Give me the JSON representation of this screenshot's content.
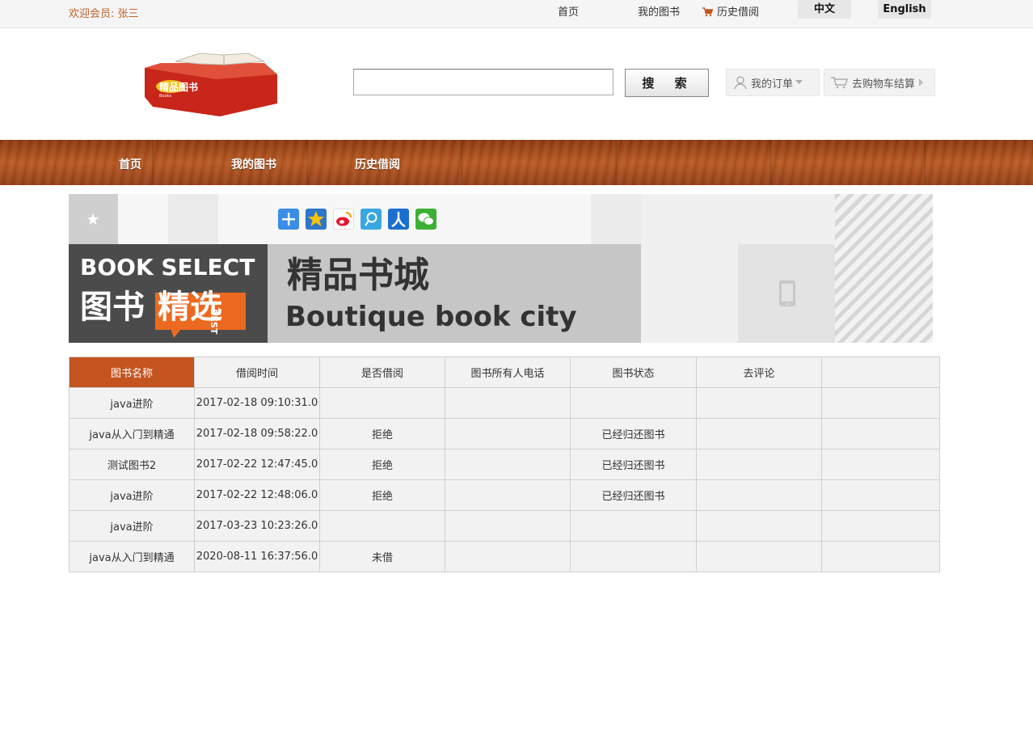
{
  "topbar": {
    "welcome": "欢迎会员: 张三",
    "links": [
      "首页",
      "我的图书",
      "历史借阅"
    ],
    "lang_zh": "中文",
    "lang_en": "English"
  },
  "header": {
    "logo_text": "精品图书",
    "logo_sub": "Books",
    "search_placeholder": "",
    "search_button": "搜 索",
    "my_orders": "我的订单",
    "cart": "去购物车结算"
  },
  "nav": {
    "items": [
      "首页",
      "我的图书",
      "历史借阅"
    ]
  },
  "banner": {
    "line1": "BOOK SELECT",
    "line2a": "图书",
    "line2b": "精选",
    "best": "BEST",
    "title_cn": "精品书城",
    "title_en": "Boutique book city"
  },
  "colors": {
    "accent": "#c4541f",
    "welcome_text": "#c0622b"
  },
  "table": {
    "headers": [
      "图书名称",
      "借阅时间",
      "是否借阅",
      "图书所有人电话",
      "图书状态",
      "去评论",
      ""
    ],
    "rows": [
      [
        "java进阶",
        "2017-02-18 09:10:31.0",
        "",
        "",
        "",
        "",
        ""
      ],
      [
        "java从入门到精通",
        "2017-02-18 09:58:22.0",
        "拒绝",
        "",
        "已经归还图书",
        "",
        ""
      ],
      [
        "测试图书2",
        "2017-02-22 12:47:45.0",
        "拒绝",
        "",
        "已经归还图书",
        "",
        ""
      ],
      [
        "java进阶",
        "2017-02-22 12:48:06.0",
        "拒绝",
        "",
        "已经归还图书",
        "",
        ""
      ],
      [
        "java进阶",
        "2017-03-23 10:23:26.0",
        "",
        "",
        "",
        "",
        ""
      ],
      [
        "java从入门到精通",
        "2020-08-11 16:37:56.0",
        "未借",
        "",
        "",
        "",
        ""
      ]
    ]
  }
}
